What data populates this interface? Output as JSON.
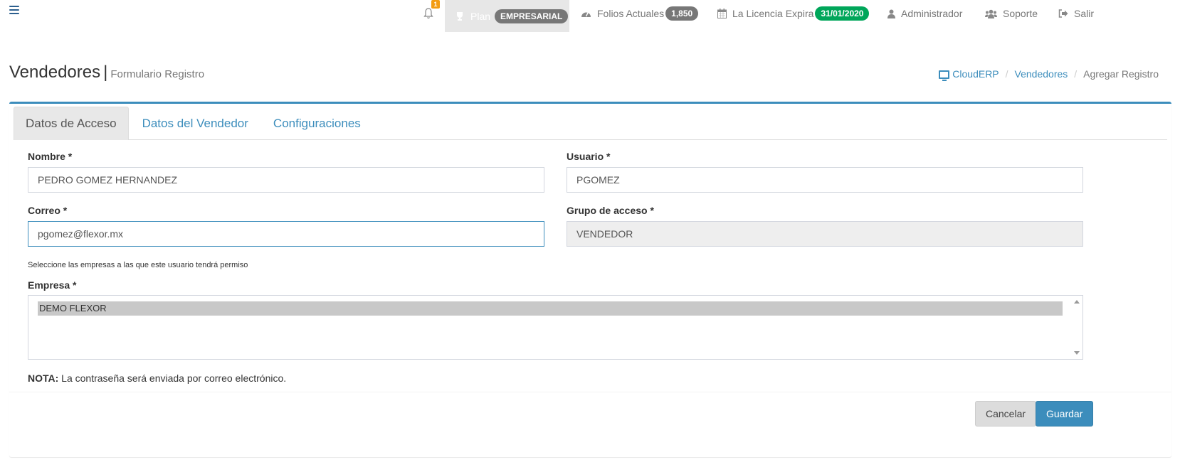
{
  "topbar": {
    "notifications_count": "1",
    "plan_label": "Plan",
    "plan_badge": "EMPRESARIAL",
    "folios_label": "Folios Actuales",
    "folios_badge": "1,850",
    "licencia_label": "La Licencia Expira",
    "licencia_badge": "31/01/2020",
    "admin_label": "Administrador",
    "soporte_label": "Soporte",
    "salir_label": "Salir"
  },
  "header": {
    "title": "Vendedores",
    "subtitle": "Formulario Registro"
  },
  "breadcrumb": {
    "home": "CloudERP",
    "section": "Vendedores",
    "current": "Agregar Registro"
  },
  "tabs": [
    {
      "label": "Datos de Acceso"
    },
    {
      "label": "Datos del Vendedor"
    },
    {
      "label": "Configuraciones"
    }
  ],
  "form": {
    "nombre_label": "Nombre *",
    "nombre_value": "PEDRO GOMEZ HERNANDEZ",
    "usuario_label": "Usuario *",
    "usuario_value": "PGOMEZ",
    "correo_label": "Correo *",
    "correo_value": "pgomez@flexor.mx",
    "grupo_label": "Grupo de acceso *",
    "grupo_value": "VENDEDOR",
    "help_text": "Seleccione las empresas a las que este usuario tendrá permiso",
    "empresa_label": "Empresa *",
    "empresa_options": [
      "DEMO FLEXOR"
    ],
    "note_bold": "NOTA:",
    "note_text": " La contraseña será enviada por correo electrónico."
  },
  "buttons": {
    "cancel": "Cancelar",
    "save": "Guardar"
  },
  "colors": {
    "accent": "#3c8dbc",
    "success": "#00a65a",
    "warning": "#f39c12"
  }
}
